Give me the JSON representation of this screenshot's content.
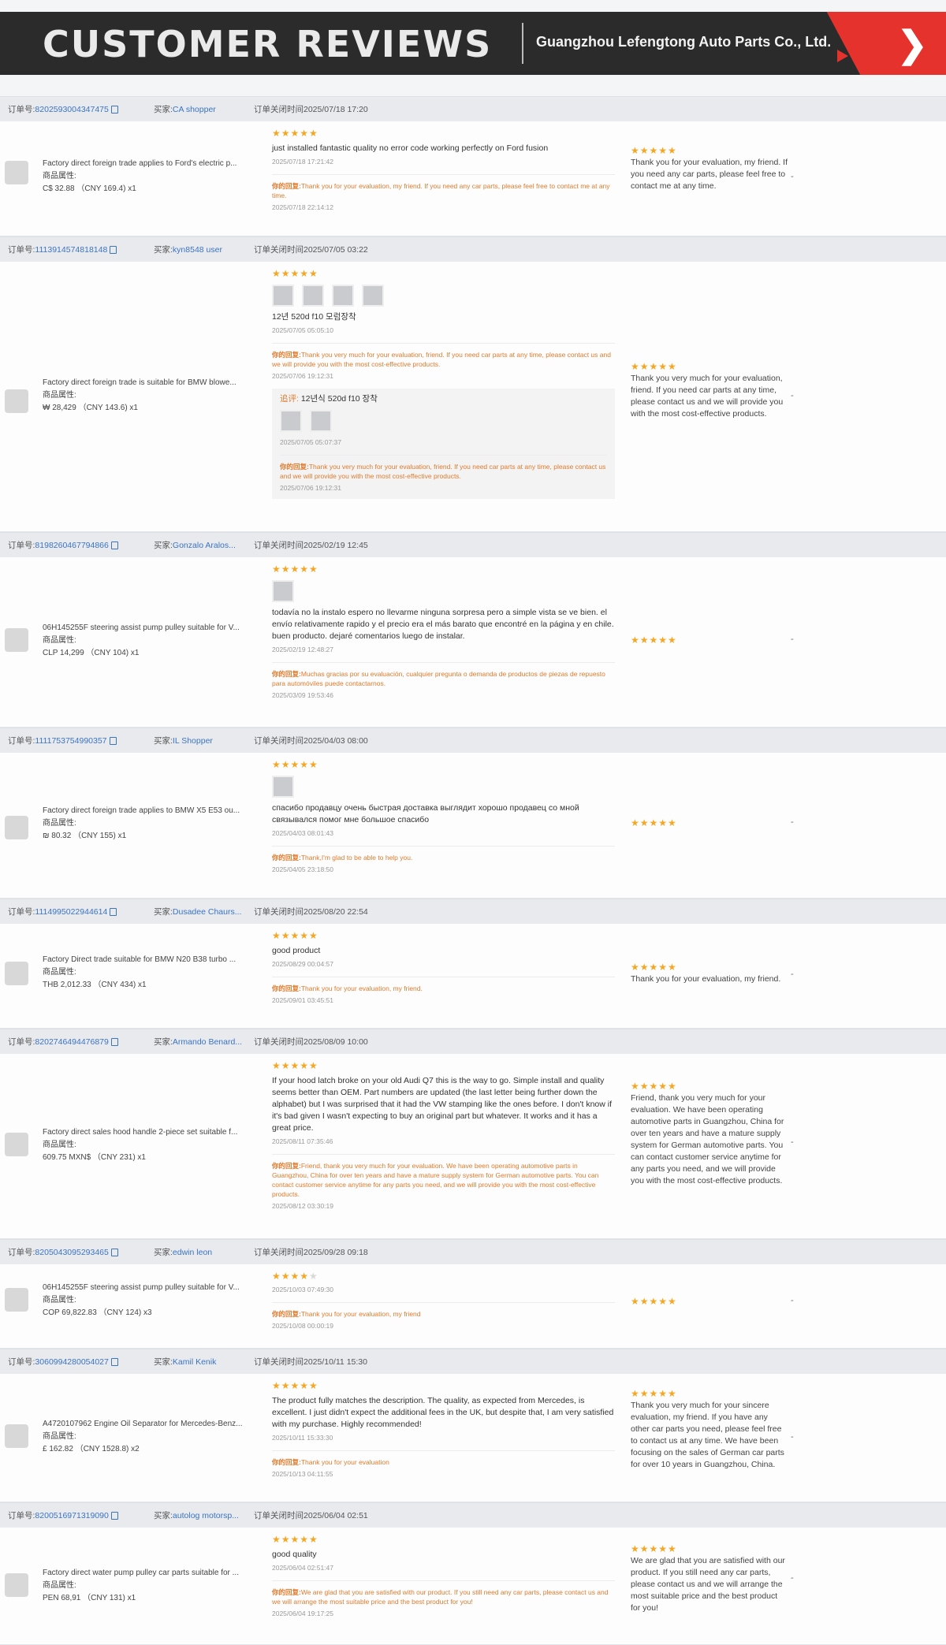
{
  "banner": {
    "title": "CUSTOMER REVIEWS",
    "company": "Guangzhou Lefengtong Auto Parts Co., Ltd."
  },
  "labels": {
    "order_no": "订单号:",
    "buyer": "买家:",
    "closed": "订单关闭时间",
    "attr": "商品属性:",
    "reply": "你的回复:",
    "followup": "追评:",
    "dash": "-"
  },
  "orders": [
    {
      "id": "8202593004347475",
      "buyer": "CA shopper",
      "closed": "2025/07/18 17:20",
      "product": "Factory direct foreign trade applies to Ford's electric p...",
      "price": "C$ 32.88 （CNY  169.4)  x1",
      "review": "just installed fantastic quality no error code working perfectly on Ford fusion",
      "review_date": "2025/07/18 17:21:42",
      "reply": "Thank you for your evaluation, my friend. If you need any car parts, please feel free to contact me at any time.",
      "reply_date": "2025/07/18 22:14:12",
      "seller": "Thank you for your evaluation, my friend. If you need any car parts, please feel free to contact me at any time."
    },
    {
      "id": "1113914574818148",
      "buyer": "kyn8548 user",
      "closed": "2025/07/05 03:22",
      "product": "Factory direct foreign trade is suitable for BMW blowe...",
      "price": "₩ 28,429 （CNY  143.6)  x1",
      "review": "12년 520d f10 모럼장착",
      "review_date": "2025/07/05 05:05:10",
      "reply": "Thank you very much for your evaluation, friend. If you need car parts at any time, please contact us and we will provide you with the most cost-effective products.",
      "reply_date": "2025/07/06 19:12:31",
      "followup": "12년식 520d f10 장착",
      "followup_date": "2025/07/05 05:07:37",
      "followup_reply": "Thank you very much for your evaluation, friend. If you need car parts at any time, please contact us and we will provide you with the most cost-effective products.",
      "followup_reply_date": "2025/07/06 19:12:31",
      "seller": "Thank you very much for your evaluation, friend. If you need car parts at any time, please contact us and we will provide you with the most cost-effective products."
    },
    {
      "id": "8198260467794866",
      "buyer": "Gonzalo Aralos...",
      "closed": "2025/02/19 12:45",
      "product": "06H145255F steering assist pump pulley suitable for V...",
      "price": "CLP 14,299 （CNY  104)  x1",
      "review": "todavía no la instalo espero no llevarme ninguna sorpresa pero a simple vista se ve bien. el envío relativamente rapido y el precio era el más barato que encontré en la página y en chile. buen producto. dejaré comentarios luego de instalar.",
      "review_date": "2025/02/19 12:48:27",
      "reply": "Muchas gracias por su evaluación, cualquier pregunta o demanda de productos de piezas de repuesto para automóviles puede contactarnos.",
      "reply_date": "2025/03/09 19:53:46",
      "seller": ""
    },
    {
      "id": "1111753754990357",
      "buyer": "IL Shopper",
      "closed": "2025/04/03 08:00",
      "product": "Factory direct foreign trade applies to BMW X5 E53 ou...",
      "price": "₪ 80.32 （CNY  155)  x1",
      "review": "спасибо продавцу очень быстрая доставка выглядит хорошо продавец со мной связывался помог мне большое спасибо",
      "review_date": "2025/04/03 08:01:43",
      "reply": "Thank,I'm glad to be able to help you.",
      "reply_date": "2025/04/05 23:18:50",
      "seller": ""
    },
    {
      "id": "1114995022944614",
      "buyer": "Dusadee Chaurs...",
      "closed": "2025/08/20 22:54",
      "product": "Factory Direct trade suitable for BMW N20 B38 turbo ...",
      "price": "THB 2,012.33 （CNY  434)  x1",
      "review": "good product",
      "review_date": "2025/08/29 00:04:57",
      "reply": "Thank you for your evaluation, my friend.",
      "reply_date": "2025/09/01 03:45:51",
      "seller": "Thank you for your evaluation, my friend."
    },
    {
      "id": "8202746494476879",
      "buyer": "Armando Benard...",
      "closed": "2025/08/09 10:00",
      "product": "Factory direct sales hood handle 2-piece set suitable f...",
      "price": "609.75 MXN$ （CNY  231)  x1",
      "review": "If your hood latch broke on your old Audi Q7 this is the way to go. Simple install and quality seems better than OEM. Part numbers are updated (the last letter being further down the alphabet) but I was surprised that it had the VW stamping like the ones before. I don't know if it's bad given I wasn't expecting to buy an original part but whatever. It works and it has a great price.",
      "review_date": "2025/08/11 07:35:46",
      "reply": "Friend, thank you very much for your evaluation. We have been operating automotive parts in Guangzhou, China for over ten years and have a mature supply system for German automotive parts. You can contact customer service anytime for any parts you need, and we will provide you with the most cost-effective products.",
      "reply_date": "2025/08/12 03:30:19",
      "seller": "Friend, thank you very much for your evaluation. We have been operating automotive parts in Guangzhou, China for over ten years and have a mature supply system for German automotive parts. You can contact customer service anytime for any parts you need, and we will provide you with the most cost-effective products."
    },
    {
      "id": "8205043095293465",
      "buyer": "edwin leon",
      "closed": "2025/09/28 09:18",
      "product": "06H145255F steering assist pump pulley suitable for V...",
      "price": "COP 69,822.83 （CNY  124)  x3",
      "review": "",
      "review_date": "2025/10/03 07:49:30",
      "reply": "Thank you for your evaluation, my friend",
      "reply_date": "2025/10/08 00:00:19",
      "seller": ""
    },
    {
      "id": "3060994280054027",
      "buyer": "Kamil Kenik",
      "closed": "2025/10/11 15:30",
      "product": "A4720107962 Engine Oil Separator for Mercedes-Benz...",
      "price": "£ 162.82 （CNY  1528.8)  x2",
      "review": "The product fully matches the description. The quality, as expected from Mercedes, is excellent. I just didn't expect the additional fees in the UK, but despite that, I am very satisfied with my purchase. Highly recommended!",
      "review_date": "2025/10/11 15:33:30",
      "reply": "Thank you for your evaluation",
      "reply_date": "2025/10/13 04:11:55",
      "seller": "Thank you very much for your sincere evaluation, my friend. If you have any other car parts you need, please feel free to contact us at any time. We have been focusing on the sales of German car parts for over 10 years in Guangzhou, China."
    },
    {
      "id": "8200516971319090",
      "buyer": "autolog motorsp...",
      "closed": "2025/06/04 02:51",
      "product": "Factory direct water pump pulley car parts suitable for ...",
      "price": "PEN 68,91 （CNY  131)  x1",
      "review": "good quality",
      "review_date": "2025/06/04 02:51:47",
      "reply": "We are glad that you are satisfied with our product. If you still need any car parts, please contact us and we will arrange the most suitable price and the best product for you!",
      "reply_date": "2025/06/04 19:17:25",
      "seller": "We are glad that you are satisfied with our product. If you still need any car parts, please contact us and we will arrange the most suitable price and the best product for you!"
    }
  ],
  "ratings": {
    "stars_full": "★★★★★",
    "stars_four": "★★★★",
    "star_empty": "★"
  }
}
